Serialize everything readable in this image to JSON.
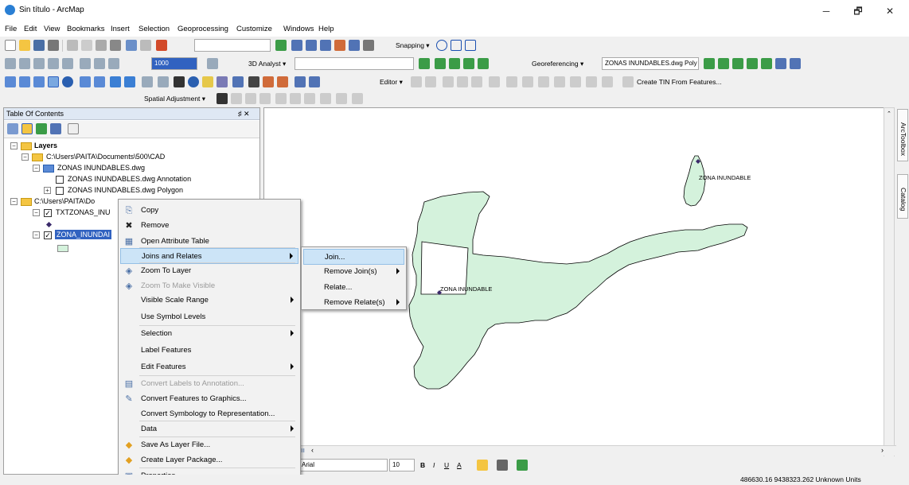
{
  "window": {
    "title": "Sin título - ArcMap",
    "min": "─",
    "max": "🗗",
    "close": "✕"
  },
  "menubar": [
    "File",
    "Edit",
    "View",
    "Bookmarks",
    "Insert",
    "Selection",
    "Geoprocessing",
    "Customize",
    "Windows",
    "Help"
  ],
  "toolbars": {
    "snapping_label": "Snapping ▾",
    "analyst3d_label": "3D Analyst ▾",
    "georef_label": "Georeferencing ▾",
    "georef_layer": "ZONAS INUNDABLES.dwg Poly",
    "editor_label": "Editor ▾",
    "create_tin": "Create TIN From Features...",
    "spatial_adjust": "Spatial Adjustment ▾",
    "scale_value": "1000"
  },
  "toc": {
    "title": "Table Of Contents",
    "pin": "♯ ✕",
    "layers_label": "Layers",
    "folder1": "C:\\Users\\PAITA\\Documents\\500\\CAD",
    "group1": "ZONAS INUNDABLES.dwg",
    "item_annotation": "ZONAS INUNDABLES.dwg Annotation",
    "item_polygon": "ZONAS INUNDABLES.dwg Polygon",
    "folder2": "C:\\Users\\PAITA\\Do",
    "layer_txt": "TXTZONAS_INU",
    "layer_zona": "ZONA_INUNDAI"
  },
  "context_menu": {
    "items": [
      {
        "label": "Copy",
        "icon": "copy-icon",
        "glyph": "⎘"
      },
      {
        "label": "Remove",
        "icon": "remove-icon",
        "glyph": "✖"
      },
      {
        "label": "Open Attribute Table",
        "icon": "table-icon",
        "glyph": "▦"
      },
      {
        "label": "Joins and Relates",
        "icon": "",
        "glyph": ""
      },
      {
        "label": "Zoom To Layer",
        "icon": "zoom-layer-icon",
        "glyph": "◈"
      },
      {
        "label": "Zoom To Make Visible",
        "icon": "zoom-visible-icon",
        "glyph": "◈"
      },
      {
        "label": "Visible Scale Range",
        "icon": "",
        "glyph": ""
      },
      {
        "label": "Use Symbol Levels",
        "icon": "",
        "glyph": ""
      },
      {
        "label": "Selection",
        "icon": "",
        "glyph": ""
      },
      {
        "label": "Label Features",
        "icon": "",
        "glyph": ""
      },
      {
        "label": "Edit Features",
        "icon": "",
        "glyph": ""
      },
      {
        "label": "Convert Labels to Annotation...",
        "icon": "convert-labels-icon",
        "glyph": "▤"
      },
      {
        "label": "Convert Features to Graphics...",
        "icon": "convert-graphics-icon",
        "glyph": "✎"
      },
      {
        "label": "Convert Symbology to Representation...",
        "icon": "",
        "glyph": ""
      },
      {
        "label": "Data",
        "icon": "",
        "glyph": ""
      },
      {
        "label": "Save As Layer File...",
        "icon": "save-layer-icon",
        "glyph": "◆"
      },
      {
        "label": "Create Layer Package...",
        "icon": "layer-package-icon",
        "glyph": "◆"
      },
      {
        "label": "Properties...",
        "icon": "properties-icon",
        "glyph": "▣"
      }
    ]
  },
  "submenu": {
    "items": [
      {
        "label": "Join..."
      },
      {
        "label": "Remove Join(s)"
      },
      {
        "label": "Relate..."
      },
      {
        "label": "Remove Relate(s)"
      }
    ]
  },
  "map": {
    "label1": "ZONA INUNDABLE",
    "label2": "ZONA INUNDABLE",
    "fill_color": "#d4f2dc",
    "stroke_color": "#000000"
  },
  "dock": {
    "toolbox": "ArcToolbox",
    "catalog": "Catalog"
  },
  "drawing": {
    "font": "Arial",
    "size": "10",
    "bold": "B",
    "italic": "I",
    "underline": "U",
    "font_color": "A"
  },
  "status": {
    "coords": "486630.16  9438323.262 Unknown Units"
  }
}
